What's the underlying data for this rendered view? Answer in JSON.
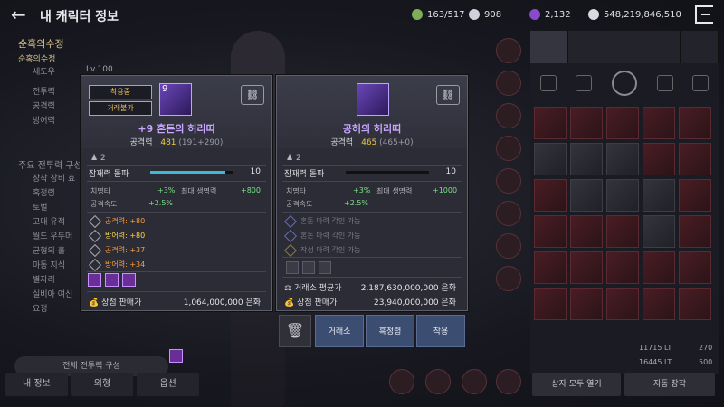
{
  "header": {
    "title": "내 캐릭터 정보",
    "resources": [
      "163/517",
      "908",
      "2,132",
      "548,219,846,510"
    ]
  },
  "left_panel": {
    "lines": [
      "순혹의수정",
      "순혹의수정",
      "새도우",
      "전투력",
      "공격력",
      "방어력",
      "주요 전투력 구성",
      "장착 장비 효",
      "혹정령",
      "토벌",
      "고대 유적",
      "월드 우두머",
      "균형의 홀",
      "마동 지식",
      "별자리",
      "실비아 여신",
      "요정"
    ],
    "level": "Lv.100",
    "compose_button": "전체 전투력 구성",
    "tabs": [
      "내 정보",
      "외형",
      "옵션"
    ]
  },
  "inventory": {
    "lt1": "11715 LT",
    "lt2": "16445 LT",
    "n1": "270",
    "n2": "500",
    "open_all": "상자 모두 열기",
    "auto_equip": "자동 장착"
  },
  "card_left": {
    "equipped": "착용중",
    "untradable": "거래불가",
    "level_badge": "9",
    "name": "+9 혼돈의 허리띠",
    "attack_label": "공격력",
    "attack_value": "481",
    "attack_detail": "(191+290)",
    "grade": "2",
    "potential_label": "잠재력 돌파",
    "potential_value": "10",
    "potential_fill": 0.9,
    "crit_label": "치명타",
    "crit_value": "+3%",
    "maxhp_label": "최대 생명력",
    "maxhp_value": "+800",
    "aspd_label": "공격속도",
    "aspd_value": "+2.5%",
    "options": [
      {
        "text": "공격력: +80",
        "color": "#ff9d3a"
      },
      {
        "text": "방어력: +80",
        "color": "#ffd84a"
      },
      {
        "text": "공격력: +37",
        "color": "#ff9d3a"
      },
      {
        "text": "방어력: +34",
        "color": "#ff9d3a"
      }
    ],
    "sell_label": "상점 판매가",
    "sell_value": "1,064,000,000 은화"
  },
  "card_right": {
    "name": "공허의 허리띠",
    "attack_label": "공격력",
    "attack_value": "465",
    "attack_detail": "(465+0)",
    "grade": "2",
    "potential_label": "잠재력 돌파",
    "potential_value": "10",
    "potential_fill": 0.0,
    "crit_label": "치명타",
    "crit_value": "+3%",
    "maxhp_label": "최대 생명력",
    "maxhp_value": "+1000",
    "aspd_label": "공격속도",
    "aspd_value": "+2.5%",
    "engraves": [
      "혼돈 마력 각인 가능",
      "혼돈 마력 각인 가능",
      "작성 마력 각인 가능"
    ],
    "avg_label": "거래소 평균가",
    "avg_value": "2,187,630,000,000 은화",
    "sell_label": "상점 판매가",
    "sell_value": "23,940,000,000 은화"
  },
  "actions": {
    "exchange": "거래소",
    "spirit": "흑정령",
    "equip": "착용"
  }
}
